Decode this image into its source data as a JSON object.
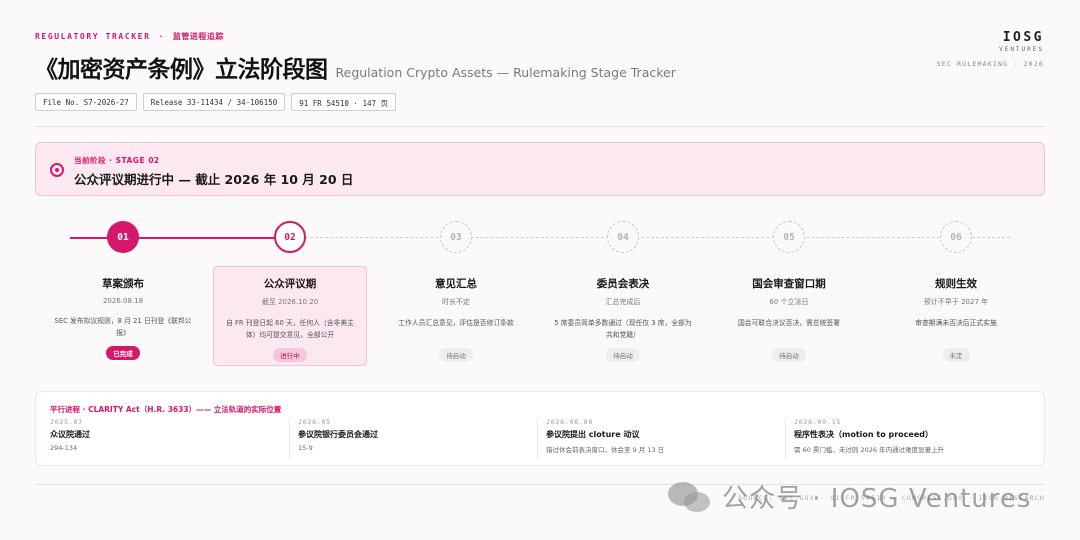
{
  "header": {
    "eyebrow_en": "REGULATORY TRACKER",
    "eyebrow_sep": "·",
    "eyebrow_cn": "监管进程追踪",
    "title_cn": "《加密资产条例》立法阶段图",
    "title_en": "Regulation Crypto Assets — Rulemaking Stage Tracker",
    "brand_name": "IOSG",
    "brand_sub": "VENTURES",
    "brand_meta": "SEC RULEMAKING · 2026"
  },
  "chips": [
    "File No. S7-2026-27",
    "Release 33-11434 / 34-106150",
    "91 FR 54510 · 147 页"
  ],
  "banner": {
    "kicker": "当前阶段 · STAGE 02",
    "title": "公众评议期进行中 — 截止 2026 年 10 月 20 日"
  },
  "stages": [
    {
      "num": "01",
      "title": "草案颁布",
      "date": "2026.08.18",
      "desc": "SEC 发布拟议规则，8 月 21 日刊登《联邦公报》",
      "status": "已完成",
      "state": "done"
    },
    {
      "num": "02",
      "title": "公众评议期",
      "date": "截至 2026.10.20",
      "desc": "自 FR 刊登日起 60 天，任何人（含非美主体）均可提交意见，全部公开",
      "status": "进行中",
      "state": "active"
    },
    {
      "num": "03",
      "title": "意见汇总",
      "date": "时长不定",
      "desc": "工作人员汇总意见，评估是否修订条款",
      "status": "待启动",
      "state": "pending"
    },
    {
      "num": "04",
      "title": "委员会表决",
      "date": "汇总完成后",
      "desc": "5 席委员简单多数通过（现任仅 3 席，全部为共和党籍）",
      "status": "待启动",
      "state": "pending"
    },
    {
      "num": "05",
      "title": "国会审查窗口期",
      "date": "60 个立法日",
      "desc": "国会可联合决议否决，需总统签署",
      "status": "待启动",
      "state": "pending"
    },
    {
      "num": "06",
      "title": "规则生效",
      "date": "预计不早于 2027 年",
      "desc": "审查期满未否决后正式实施",
      "status": "未定",
      "state": "pending"
    }
  ],
  "parallel": {
    "heading": "平行进程 · CLARITY Act（H.R. 3633）—— 立法轨道的实际位置",
    "items": [
      {
        "date": "2025.07",
        "title": "众议院通过",
        "note": "294-134"
      },
      {
        "date": "2026.05",
        "title": "参议院银行委员会通过",
        "note": "15-9"
      },
      {
        "date": "2026.08.08",
        "title": "参议院提出 cloture 动议",
        "note": "错过休会前表决窗口，休会至 9 月 13 日"
      },
      {
        "date": "2026.09.15",
        "title": "程序性表决（motion to proceed）",
        "note": "需 60 票门槛，未过则 2026 年内通过难度显著上升"
      }
    ]
  },
  "footer": "SOURCE: SEC.GOV · 91 FR 54510 · CONGRESS.GOV · IOSG RESEARCH",
  "watermark": "公众号 · IOSG Ventures",
  "colors": {
    "accent": "#d6186b",
    "accent_light": "#fce8f1",
    "pending": "#b4b4b4"
  }
}
